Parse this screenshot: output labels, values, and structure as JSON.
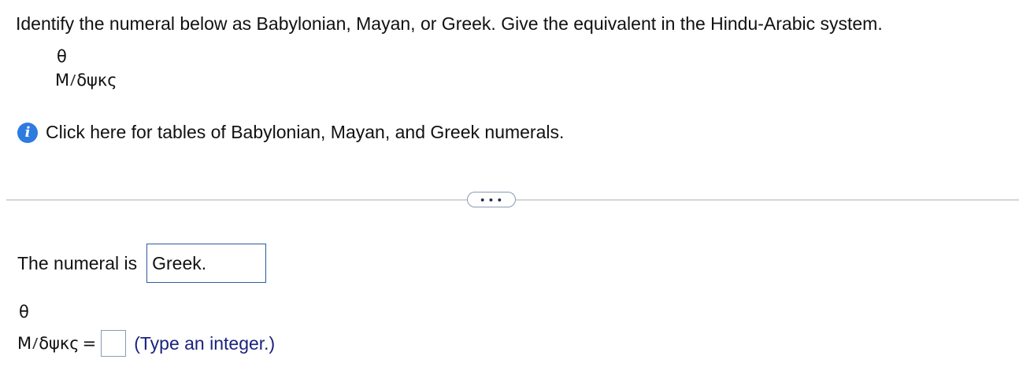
{
  "question": {
    "text": "Identify the numeral below as Babylonian, Mayan, or Greek. Give the equivalent in the Hindu-Arabic system."
  },
  "numeral": {
    "top": "θ",
    "prefix": "M",
    "slash": "/",
    "letters": "δψκς"
  },
  "info": {
    "icon": "info-icon",
    "link_text": "Click here for tables of Babylonian, Mayan, and Greek numerals."
  },
  "divider": {
    "more_label": "• • •"
  },
  "answer": {
    "label": "The numeral is",
    "value": "Greek."
  },
  "equation": {
    "equals": "=",
    "input_value": "",
    "hint": "(Type an integer.)"
  },
  "colors": {
    "info_icon": "#2e7be0",
    "answer_border": "#2c5aa0",
    "hint_text": "#1a237e"
  }
}
